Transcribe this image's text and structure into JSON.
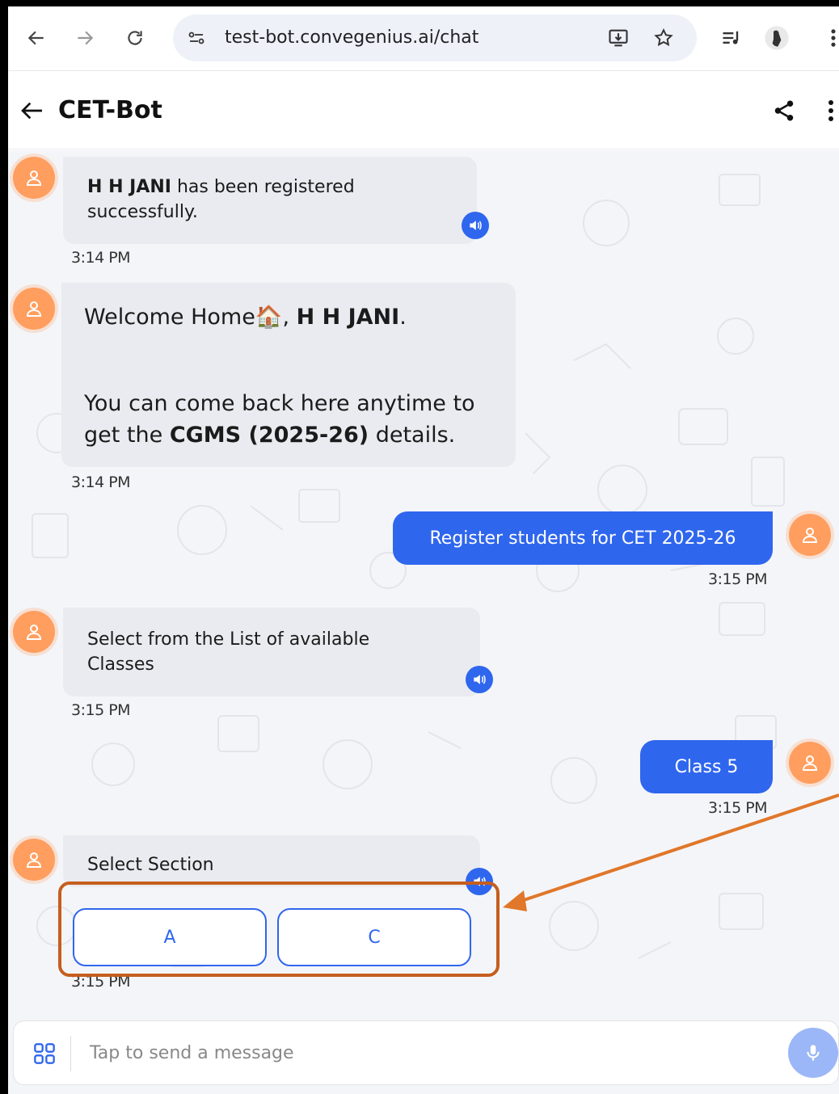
{
  "browser": {
    "url": "test-bot.convegenius.ai/chat",
    "icons": [
      "back-arrow-icon",
      "forward-arrow-icon",
      "reload-icon",
      "site-settings-icon",
      "install-app-icon",
      "bookmark-star-icon",
      "media-control-icon",
      "profile-avatar-icon",
      "more-menu-icon"
    ]
  },
  "header": {
    "title": "CET-Bot",
    "icons": [
      "back-arrow-icon",
      "share-icon",
      "more-vertical-icon"
    ]
  },
  "messages": [
    {
      "from": "bot",
      "bold": "H H JANI",
      "text": " has been registered successfully.",
      "time": "3:14 PM"
    },
    {
      "from": "bot",
      "welcome_prefix": "Welcome Home",
      "emoji": "🏠",
      "name": "H H JANI",
      "line2_pre": "You can come back here anytime to get the ",
      "line2_bold": "CGMS (2025-26)",
      "line2_post": " details.",
      "time": "3:14 PM"
    },
    {
      "from": "user",
      "text": "Register students for CET 2025-26",
      "time": "3:15 PM"
    },
    {
      "from": "bot",
      "text": "Select from the List of available Classes",
      "time": "3:15 PM"
    },
    {
      "from": "user",
      "text": "Class 5",
      "time": "3:15 PM"
    },
    {
      "from": "bot",
      "text": "Select Section",
      "options": [
        "A",
        "C"
      ],
      "time": "3:15 PM"
    }
  ],
  "input": {
    "placeholder": "Tap to send a message"
  },
  "colors": {
    "accent": "#2f66ee",
    "avatar": "#ff9e5e",
    "annotation": "#c65e1e",
    "bot_bubble": "#e9ebf0"
  }
}
